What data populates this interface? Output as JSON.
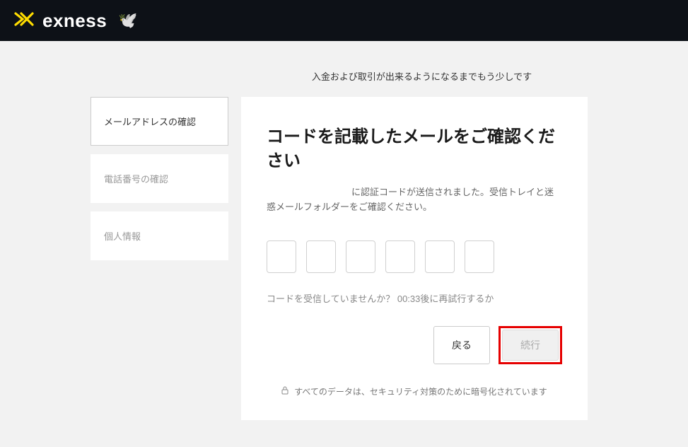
{
  "header": {
    "brand": "exness"
  },
  "page": {
    "subtitle": "入金および取引が出来るようになるまでもう少しです"
  },
  "sidebar": {
    "steps": [
      {
        "label": "メールアドレスの確認",
        "active": true
      },
      {
        "label": "電話番号の確認",
        "active": false
      },
      {
        "label": "個人情報",
        "active": false
      }
    ]
  },
  "card": {
    "title": "コードを記載したメールをご確認ください",
    "description": "に認証コードが送信されました。受信トレイと迷惑メールフォルダーをご確認ください。",
    "resend_prefix": "コードを受信していませんか？ ",
    "resend_timer": "00:33",
    "resend_suffix": "後に再試行するか",
    "back_label": "戻る",
    "continue_label": "続行",
    "security_note": "すべてのデータは、セキュリティ対策のために暗号化されています"
  }
}
